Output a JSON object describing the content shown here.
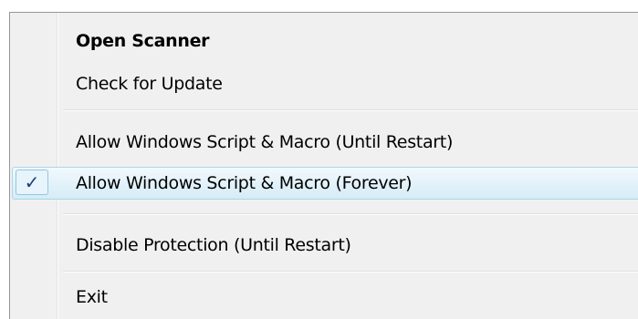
{
  "menu": {
    "items": [
      {
        "label": "Open Scanner"
      },
      {
        "label": "Check for Update"
      },
      {
        "label": "Allow Windows Script & Macro (Until Restart)"
      },
      {
        "label": "Allow Windows Script & Macro (Forever)",
        "checked": true,
        "check_glyph": "✓"
      },
      {
        "label": "Disable Protection (Until Restart)"
      },
      {
        "label": "Exit"
      }
    ],
    "colors": {
      "background": "#f0f0f0",
      "highlight": "#e3f2fa",
      "highlight_border": "#a8d8eb",
      "check": "#1c3f77"
    }
  }
}
